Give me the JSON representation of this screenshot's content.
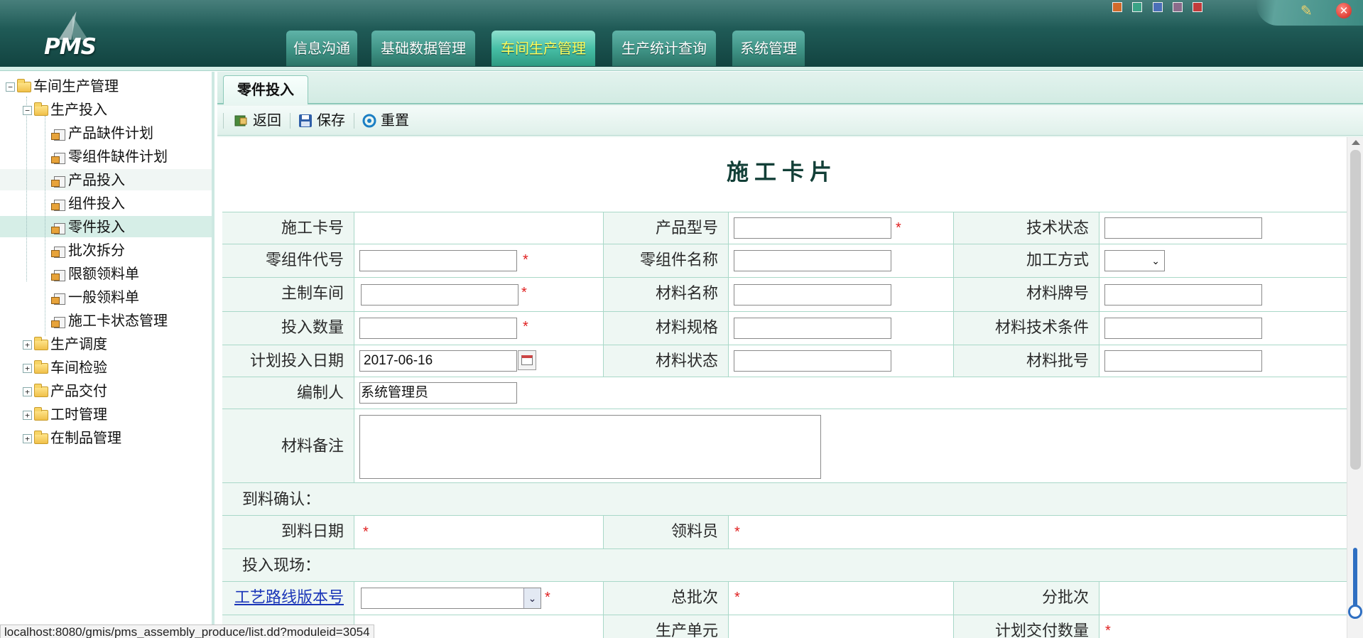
{
  "app": {
    "logo_text": "PMS"
  },
  "nav": {
    "tabs": [
      "信息沟通",
      "基础数据管理",
      "车间生产管理",
      "生产统计查询",
      "系统管理"
    ],
    "active_index": 2
  },
  "window_controls": {
    "skins": [
      "#d06a2a",
      "#3aa386",
      "#4b6fb8",
      "#8b6b8b",
      "#c23b3b"
    ]
  },
  "tree": {
    "root": "车间生产管理",
    "group": "生产投入",
    "items": [
      "产品缺件计划",
      "零组件缺件计划",
      "产品投入",
      "组件投入",
      "零件投入",
      "批次拆分",
      "限额领料单",
      "一般领料单",
      "施工卡状态管理"
    ],
    "collapsed": [
      "生产调度",
      "车间检验",
      "产品交付",
      "工时管理",
      "在制品管理"
    ],
    "selected": "零件投入"
  },
  "tab": {
    "title": "零件投入"
  },
  "toolbar": {
    "back": "返回",
    "save": "保存",
    "reset": "重置"
  },
  "form": {
    "title": "施工卡片",
    "labels": {
      "card_no": "施工卡号",
      "product_model": "产品型号",
      "tech_status": "技术状态",
      "part_code": "零组件代号",
      "part_name": "零组件名称",
      "process_method": "加工方式",
      "main_workshop": "主制车间",
      "material_name": "材料名称",
      "material_grade": "材料牌号",
      "input_qty": "投入数量",
      "material_spec": "材料规格",
      "material_tech_cond": "材料技术条件",
      "plan_date": "计划投入日期",
      "material_state": "材料状态",
      "material_batch": "材料批号",
      "editor": "编制人",
      "material_note": "材料备注",
      "arrival_date": "到料日期",
      "receiver": "领料员",
      "route_version": "工艺路线版本号",
      "total_batches": "总批次",
      "sub_batches": "分批次",
      "production_unit": "生产单元",
      "planned_delivery_qty": "计划交付数量"
    },
    "values": {
      "plan_date": "2017-06-16",
      "editor": "系统管理员"
    },
    "sections": {
      "arrival": "到料确认：",
      "site": "投入现场："
    },
    "required_mark": "*"
  },
  "status_bar": {
    "url": "localhost:8080/gmis/pms_assembly_produce/list.dd?moduleid=3054"
  }
}
